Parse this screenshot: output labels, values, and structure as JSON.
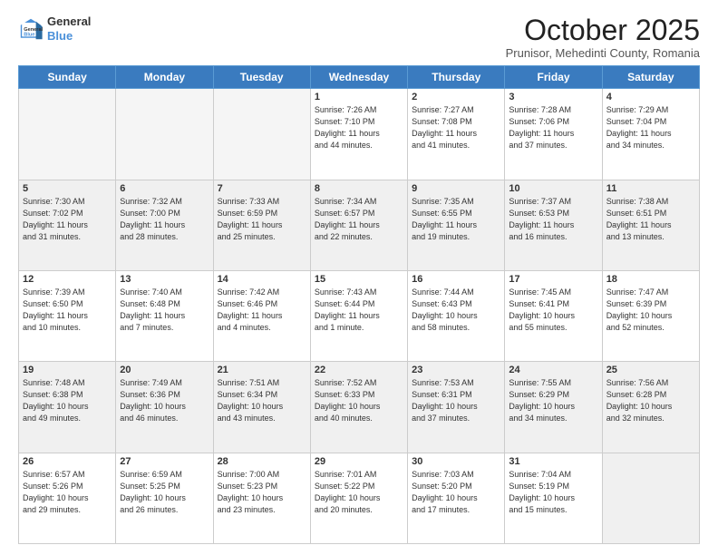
{
  "header": {
    "logo_line1": "General",
    "logo_line2": "Blue",
    "month_title": "October 2025",
    "location": "Prunisor, Mehedinti County, Romania"
  },
  "days_of_week": [
    "Sunday",
    "Monday",
    "Tuesday",
    "Wednesday",
    "Thursday",
    "Friday",
    "Saturday"
  ],
  "weeks": [
    [
      {
        "day": "",
        "info": ""
      },
      {
        "day": "",
        "info": ""
      },
      {
        "day": "",
        "info": ""
      },
      {
        "day": "1",
        "info": "Sunrise: 7:26 AM\nSunset: 7:10 PM\nDaylight: 11 hours\nand 44 minutes."
      },
      {
        "day": "2",
        "info": "Sunrise: 7:27 AM\nSunset: 7:08 PM\nDaylight: 11 hours\nand 41 minutes."
      },
      {
        "day": "3",
        "info": "Sunrise: 7:28 AM\nSunset: 7:06 PM\nDaylight: 11 hours\nand 37 minutes."
      },
      {
        "day": "4",
        "info": "Sunrise: 7:29 AM\nSunset: 7:04 PM\nDaylight: 11 hours\nand 34 minutes."
      }
    ],
    [
      {
        "day": "5",
        "info": "Sunrise: 7:30 AM\nSunset: 7:02 PM\nDaylight: 11 hours\nand 31 minutes."
      },
      {
        "day": "6",
        "info": "Sunrise: 7:32 AM\nSunset: 7:00 PM\nDaylight: 11 hours\nand 28 minutes."
      },
      {
        "day": "7",
        "info": "Sunrise: 7:33 AM\nSunset: 6:59 PM\nDaylight: 11 hours\nand 25 minutes."
      },
      {
        "day": "8",
        "info": "Sunrise: 7:34 AM\nSunset: 6:57 PM\nDaylight: 11 hours\nand 22 minutes."
      },
      {
        "day": "9",
        "info": "Sunrise: 7:35 AM\nSunset: 6:55 PM\nDaylight: 11 hours\nand 19 minutes."
      },
      {
        "day": "10",
        "info": "Sunrise: 7:37 AM\nSunset: 6:53 PM\nDaylight: 11 hours\nand 16 minutes."
      },
      {
        "day": "11",
        "info": "Sunrise: 7:38 AM\nSunset: 6:51 PM\nDaylight: 11 hours\nand 13 minutes."
      }
    ],
    [
      {
        "day": "12",
        "info": "Sunrise: 7:39 AM\nSunset: 6:50 PM\nDaylight: 11 hours\nand 10 minutes."
      },
      {
        "day": "13",
        "info": "Sunrise: 7:40 AM\nSunset: 6:48 PM\nDaylight: 11 hours\nand 7 minutes."
      },
      {
        "day": "14",
        "info": "Sunrise: 7:42 AM\nSunset: 6:46 PM\nDaylight: 11 hours\nand 4 minutes."
      },
      {
        "day": "15",
        "info": "Sunrise: 7:43 AM\nSunset: 6:44 PM\nDaylight: 11 hours\nand 1 minute."
      },
      {
        "day": "16",
        "info": "Sunrise: 7:44 AM\nSunset: 6:43 PM\nDaylight: 10 hours\nand 58 minutes."
      },
      {
        "day": "17",
        "info": "Sunrise: 7:45 AM\nSunset: 6:41 PM\nDaylight: 10 hours\nand 55 minutes."
      },
      {
        "day": "18",
        "info": "Sunrise: 7:47 AM\nSunset: 6:39 PM\nDaylight: 10 hours\nand 52 minutes."
      }
    ],
    [
      {
        "day": "19",
        "info": "Sunrise: 7:48 AM\nSunset: 6:38 PM\nDaylight: 10 hours\nand 49 minutes."
      },
      {
        "day": "20",
        "info": "Sunrise: 7:49 AM\nSunset: 6:36 PM\nDaylight: 10 hours\nand 46 minutes."
      },
      {
        "day": "21",
        "info": "Sunrise: 7:51 AM\nSunset: 6:34 PM\nDaylight: 10 hours\nand 43 minutes."
      },
      {
        "day": "22",
        "info": "Sunrise: 7:52 AM\nSunset: 6:33 PM\nDaylight: 10 hours\nand 40 minutes."
      },
      {
        "day": "23",
        "info": "Sunrise: 7:53 AM\nSunset: 6:31 PM\nDaylight: 10 hours\nand 37 minutes."
      },
      {
        "day": "24",
        "info": "Sunrise: 7:55 AM\nSunset: 6:29 PM\nDaylight: 10 hours\nand 34 minutes."
      },
      {
        "day": "25",
        "info": "Sunrise: 7:56 AM\nSunset: 6:28 PM\nDaylight: 10 hours\nand 32 minutes."
      }
    ],
    [
      {
        "day": "26",
        "info": "Sunrise: 6:57 AM\nSunset: 5:26 PM\nDaylight: 10 hours\nand 29 minutes."
      },
      {
        "day": "27",
        "info": "Sunrise: 6:59 AM\nSunset: 5:25 PM\nDaylight: 10 hours\nand 26 minutes."
      },
      {
        "day": "28",
        "info": "Sunrise: 7:00 AM\nSunset: 5:23 PM\nDaylight: 10 hours\nand 23 minutes."
      },
      {
        "day": "29",
        "info": "Sunrise: 7:01 AM\nSunset: 5:22 PM\nDaylight: 10 hours\nand 20 minutes."
      },
      {
        "day": "30",
        "info": "Sunrise: 7:03 AM\nSunset: 5:20 PM\nDaylight: 10 hours\nand 17 minutes."
      },
      {
        "day": "31",
        "info": "Sunrise: 7:04 AM\nSunset: 5:19 PM\nDaylight: 10 hours\nand 15 minutes."
      },
      {
        "day": "",
        "info": ""
      }
    ]
  ]
}
